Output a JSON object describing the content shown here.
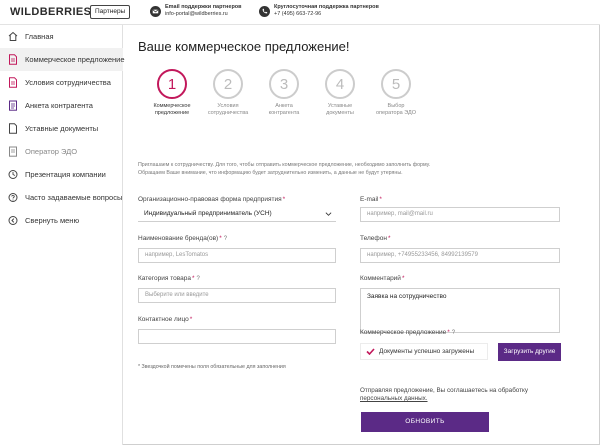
{
  "header": {
    "logo": "WILDBERRIES",
    "partners_button": "Партнеры",
    "email": {
      "title": "Email поддержки партнеров",
      "value": "info-portal@wildberries.ru",
      "icon": "mail-icon"
    },
    "phone": {
      "title": "Круглосуточная поддержка партнеров",
      "value": "+7 (495) 663-72-96",
      "icon": "phone-icon"
    }
  },
  "sidebar": {
    "items": [
      {
        "label": "Главная",
        "icon": "home-icon"
      },
      {
        "label": "Коммерческое предложение",
        "icon": "document-icon",
        "active": true
      },
      {
        "label": "Условия сотрудничества",
        "icon": "document-icon"
      },
      {
        "label": "Анкета контрагента",
        "icon": "form-icon"
      },
      {
        "label": "Уставные документы",
        "icon": "document-icon"
      },
      {
        "label": "Оператор ЭДО",
        "icon": "form-icon",
        "disabled": true
      },
      {
        "label": "Презентация компании",
        "icon": "clock-icon"
      },
      {
        "label": "Часто задаваемые вопросы",
        "icon": "question-icon"
      },
      {
        "label": "Свернуть меню",
        "icon": "collapse-icon"
      }
    ]
  },
  "main": {
    "title": "Ваше коммерческое предложение!",
    "steps": [
      {
        "number": "1",
        "label_1": "Коммерческое",
        "label_2": "предложение",
        "active": true
      },
      {
        "number": "2",
        "label_1": "Условия",
        "label_2": "сотрудничества"
      },
      {
        "number": "3",
        "label_1": "Анкета",
        "label_2": "контрагента"
      },
      {
        "number": "4",
        "label_1": "Уставные",
        "label_2": "документы"
      },
      {
        "number": "5",
        "label_1": "Выбор",
        "label_2": "оператора ЭДО"
      }
    ],
    "intro_1": "Приглашаем к сотрудничеству. Для того, чтобы отправить коммерческое предложение, необходимо заполнить форму.",
    "intro_2": "Обращаем Ваше внимание, что информацию будет затруднительно изменить, а данные не будут утеряны.",
    "form": {
      "org_form": {
        "label": "Организационно-правовая форма предприятия",
        "value": "Индивидуальный предприниматель (УСН)"
      },
      "brand": {
        "label": "Наименование бренда(ов)",
        "placeholder": "например, LesTomatos"
      },
      "category": {
        "label": "Категория товара",
        "placeholder": "Выберите или введите"
      },
      "contact": {
        "label": "Контактное лицо",
        "placeholder": ""
      },
      "email": {
        "label": "E-mail",
        "placeholder": "например, mail@mail.ru"
      },
      "phone": {
        "label": "Телефон",
        "placeholder": "например, +74955233456, 84992139579"
      },
      "comment": {
        "label": "Комментарий",
        "value": "Заявка на сотрудничество"
      },
      "proposal": {
        "label": "Коммерческое предложение",
        "status": "Документы успешно загружены",
        "upload_button": "Загрузить другие"
      }
    },
    "required_mark": "*",
    "help_mark": "?",
    "footnote": "* Звездочкой помечены поля обязательные для заполнения",
    "agreement_text": "Отправляя предложение, Вы соглашаетесь на обработку",
    "agreement_link": "персональных данных.",
    "submit_button": "ОБНОВИТЬ"
  },
  "colors": {
    "accent": "#c2185b",
    "button": "#5b2a86"
  }
}
